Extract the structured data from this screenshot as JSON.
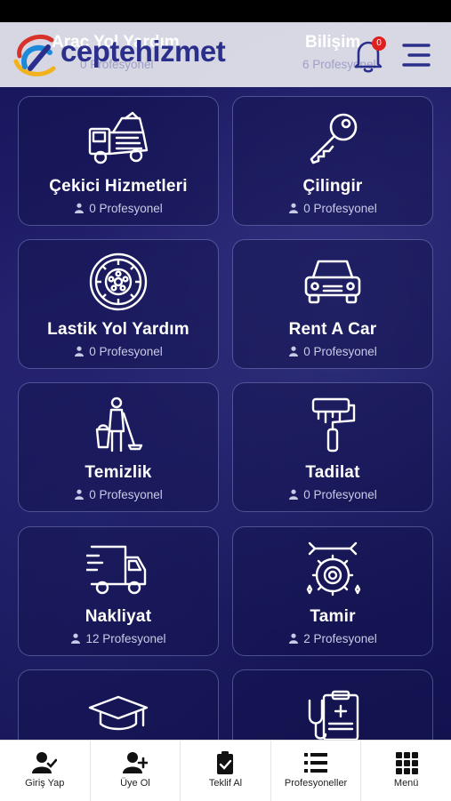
{
  "header": {
    "logo_text": "ceptehizmet",
    "notification_count": "0",
    "partial_card_left_title": "Araç Yol Yardım",
    "partial_card_left_sub": "0 Profesyonel",
    "partial_card_right_title": "Bilişim",
    "partial_card_right_sub": "6 Profesyonel"
  },
  "categories": [
    {
      "title": "Çekici Hizmetleri",
      "sub": "0 Profesyonel",
      "icon": "tow-truck-icon"
    },
    {
      "title": "Çilingir",
      "sub": "0 Profesyonel",
      "icon": "key-icon"
    },
    {
      "title": "Lastik Yol Yardım",
      "sub": "0 Profesyonel",
      "icon": "tire-icon"
    },
    {
      "title": "Rent A Car",
      "sub": "0 Profesyonel",
      "icon": "car-icon"
    },
    {
      "title": "Temizlik",
      "sub": "0 Profesyonel",
      "icon": "cleaner-icon"
    },
    {
      "title": "Tadilat",
      "sub": "0 Profesyonel",
      "icon": "paint-roller-icon"
    },
    {
      "title": "Nakliyat",
      "sub": "12 Profesyonel",
      "icon": "truck-icon"
    },
    {
      "title": "Tamir",
      "sub": "2 Profesyonel",
      "icon": "gear-wrench-icon"
    },
    {
      "title": "",
      "sub": "",
      "icon": "graduation-cap-icon"
    },
    {
      "title": "",
      "sub": "",
      "icon": "stethoscope-icon"
    }
  ],
  "tabbar": [
    {
      "label": "Giriş Yap",
      "icon": "user-check-icon"
    },
    {
      "label": "Üye Ol",
      "icon": "user-plus-icon"
    },
    {
      "label": "Teklif Al",
      "icon": "clipboard-check-icon"
    },
    {
      "label": "Profesyoneller",
      "icon": "list-icon"
    },
    {
      "label": "Menü",
      "icon": "grid-icon"
    }
  ],
  "colors": {
    "background": "#1b1a5c",
    "brand": "#2b2f8c",
    "badge": "#e02020"
  }
}
